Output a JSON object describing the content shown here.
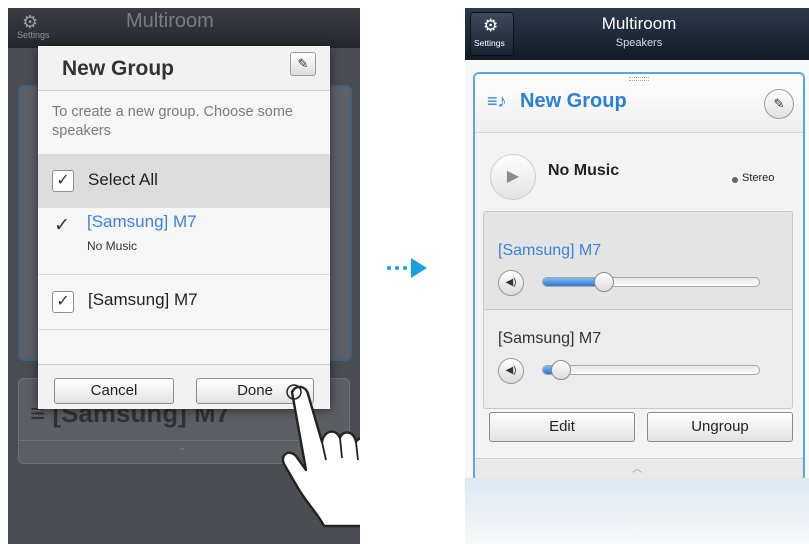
{
  "left_screen": {
    "header": {
      "settings_label": "Settings",
      "title": "Multiroom"
    },
    "background_group_label": "[Samsung] M7",
    "dialog": {
      "title": "New Group",
      "hint": "To create a new group. Choose some speakers",
      "select_all_label": "Select All",
      "speakers": [
        {
          "name": "[Samsung] M7",
          "status": "No Music",
          "selected": true
        },
        {
          "name": "[Samsung] M7",
          "status": "",
          "selected": true
        }
      ],
      "cancel_label": "Cancel",
      "done_label": "Done"
    }
  },
  "right_screen": {
    "header": {
      "settings_label": "Settings",
      "title": "Multiroom",
      "subtitle": "Speakers"
    },
    "group": {
      "title": "New Group",
      "now_playing": "No Music",
      "mode": "Stereo",
      "speakers": [
        {
          "name": "[Samsung] M7",
          "volume": 0.28,
          "active": true
        },
        {
          "name": "[Samsung] M7",
          "volume": 0.08,
          "active": false
        }
      ],
      "edit_label": "Edit",
      "ungroup_label": "Ungroup"
    }
  },
  "colors": {
    "accent": "#2a7fd6",
    "arrow": "#1aa0e0",
    "dim_bg": "#4a4d52",
    "header_dark": "#1b2533"
  },
  "icons": [
    "gear-icon",
    "pencil-icon",
    "check-icon",
    "list-music-icon",
    "play-icon",
    "speaker-volume-icon",
    "chevron-up-icon",
    "chevron-down-icon",
    "hand-pointer-icon",
    "arrow-right-icon"
  ]
}
